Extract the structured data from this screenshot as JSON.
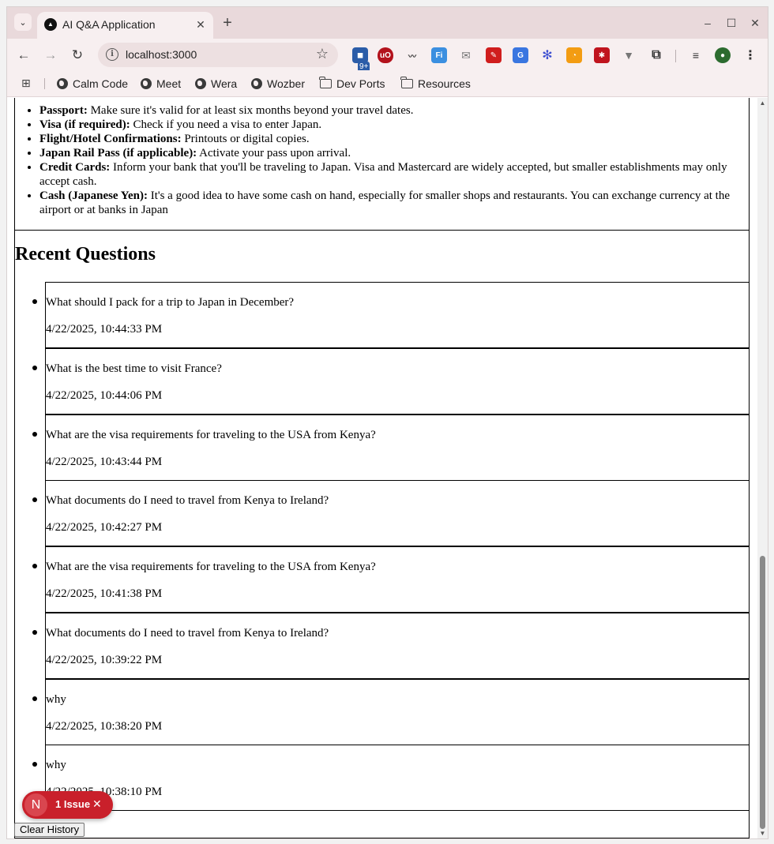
{
  "browser": {
    "tab_title": "AI Q&A Application",
    "url": "localhost:3000",
    "extension_badge": "9+",
    "bookmarks": [
      {
        "label": "Calm Code",
        "icon": "globe-icon"
      },
      {
        "label": "Meet",
        "icon": "globe-icon"
      },
      {
        "label": "Wera",
        "icon": "globe-icon"
      },
      {
        "label": "Wozber",
        "icon": "globe-icon"
      },
      {
        "label": "Dev Ports",
        "icon": "folder-icon"
      },
      {
        "label": "Resources",
        "icon": "folder-icon"
      }
    ]
  },
  "answer": {
    "items": [
      {
        "term": "Passport:",
        "text": " Make sure it's valid for at least six months beyond your travel dates."
      },
      {
        "term": "Visa (if required):",
        "text": " Check if you need a visa to enter Japan."
      },
      {
        "term": "Flight/Hotel Confirmations:",
        "text": " Printouts or digital copies."
      },
      {
        "term": "Japan Rail Pass (if applicable):",
        "text": " Activate your pass upon arrival."
      },
      {
        "term": "Credit Cards:",
        "text": " Inform your bank that you'll be traveling to Japan. Visa and Mastercard are widely accepted, but smaller establishments may only accept cash."
      },
      {
        "term": "Cash (Japanese Yen):",
        "text": " It's a good idea to have some cash on hand, especially for smaller shops and restaurants. You can exchange currency at the airport or at banks in Japan"
      }
    ]
  },
  "recent": {
    "title": "Recent Questions",
    "questions": [
      {
        "text": "What should I pack for a trip to Japan in December?",
        "time": "4/22/2025, 10:44:33 PM"
      },
      {
        "text": "What is the best time to visit France?",
        "time": "4/22/2025, 10:44:06 PM"
      },
      {
        "text": "What are the visa requirements for traveling to the USA from Kenya?",
        "time": "4/22/2025, 10:43:44 PM"
      },
      {
        "text": "What documents do I need to travel from Kenya to Ireland?",
        "time": "4/22/2025, 10:42:27 PM"
      },
      {
        "text": "What are the visa requirements for traveling to the USA from Kenya?",
        "time": "4/22/2025, 10:41:38 PM"
      },
      {
        "text": "What documents do I need to travel from Kenya to Ireland?",
        "time": "4/22/2025, 10:39:22 PM"
      },
      {
        "text": "why",
        "time": "4/22/2025, 10:38:20 PM"
      },
      {
        "text": "why",
        "time": "4/22/2025, 10:38:10 PM"
      }
    ],
    "clear_label": "Clear History"
  },
  "dev_overlay": {
    "logo": "N",
    "issues_label": "1 Issue"
  }
}
